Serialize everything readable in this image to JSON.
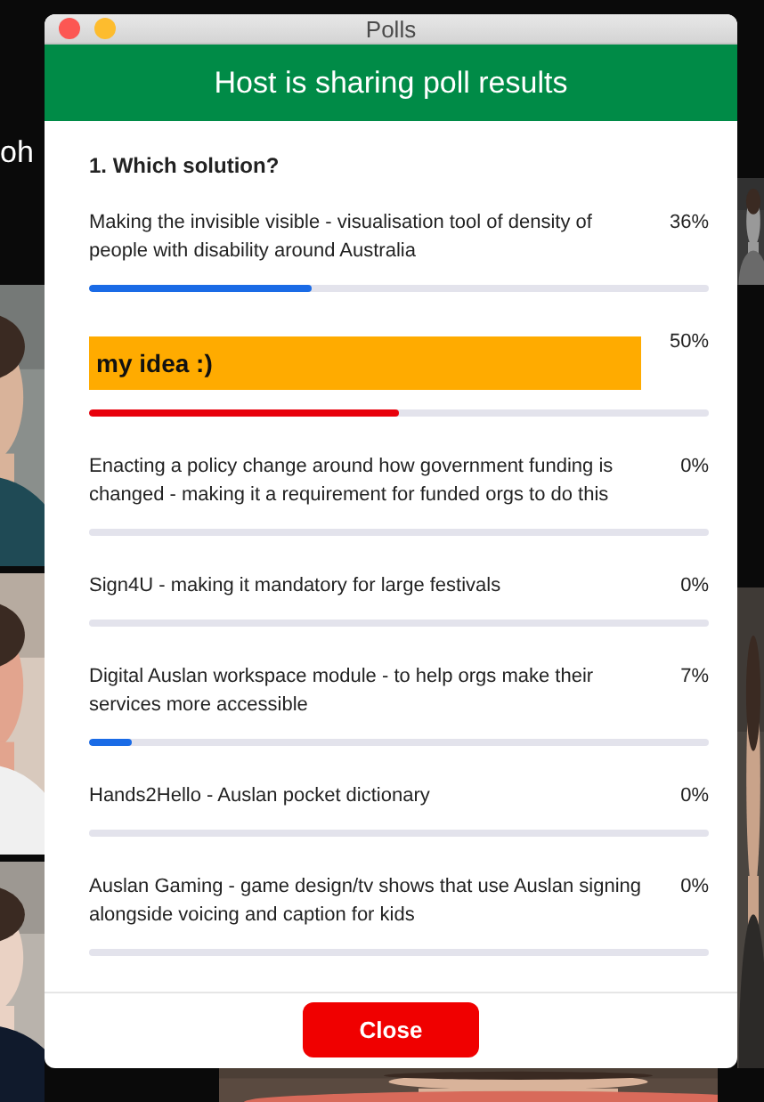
{
  "background": {
    "name_label": "oh"
  },
  "window": {
    "title": "Polls"
  },
  "banner": {
    "text": "Host is sharing poll results"
  },
  "question": "1. Which solution?",
  "options": [
    {
      "kind": "text",
      "label": "Making the invisible visible - visualisation tool of density of people with disability around Australia",
      "percent": "36%",
      "level": 0.36,
      "color": "#1a6be6"
    },
    {
      "kind": "highlight",
      "label": "my idea :)",
      "percent": "50%",
      "level": 0.5,
      "color": "#e8000b"
    },
    {
      "kind": "text",
      "label": "Enacting a policy change around how government funding is changed - making it a requirement for funded orgs to do this",
      "percent": "0%"
    },
    {
      "kind": "text",
      "label": "Sign4U - making it mandatory for large festivals",
      "percent": "0%"
    },
    {
      "kind": "text",
      "label": "Digital Auslan workspace module - to help orgs make their services more accessible",
      "percent": "7%",
      "level": 0.07,
      "color": "#1a6be6"
    },
    {
      "kind": "text",
      "label": "Hands2Hello - Auslan pocket dictionary",
      "percent": "0%"
    },
    {
      "kind": "text",
      "label": "Auslan Gaming - game design/tv shows that use Auslan signing alongside voicing and caption for kids",
      "percent": "0%"
    }
  ],
  "close_button": "Close"
}
